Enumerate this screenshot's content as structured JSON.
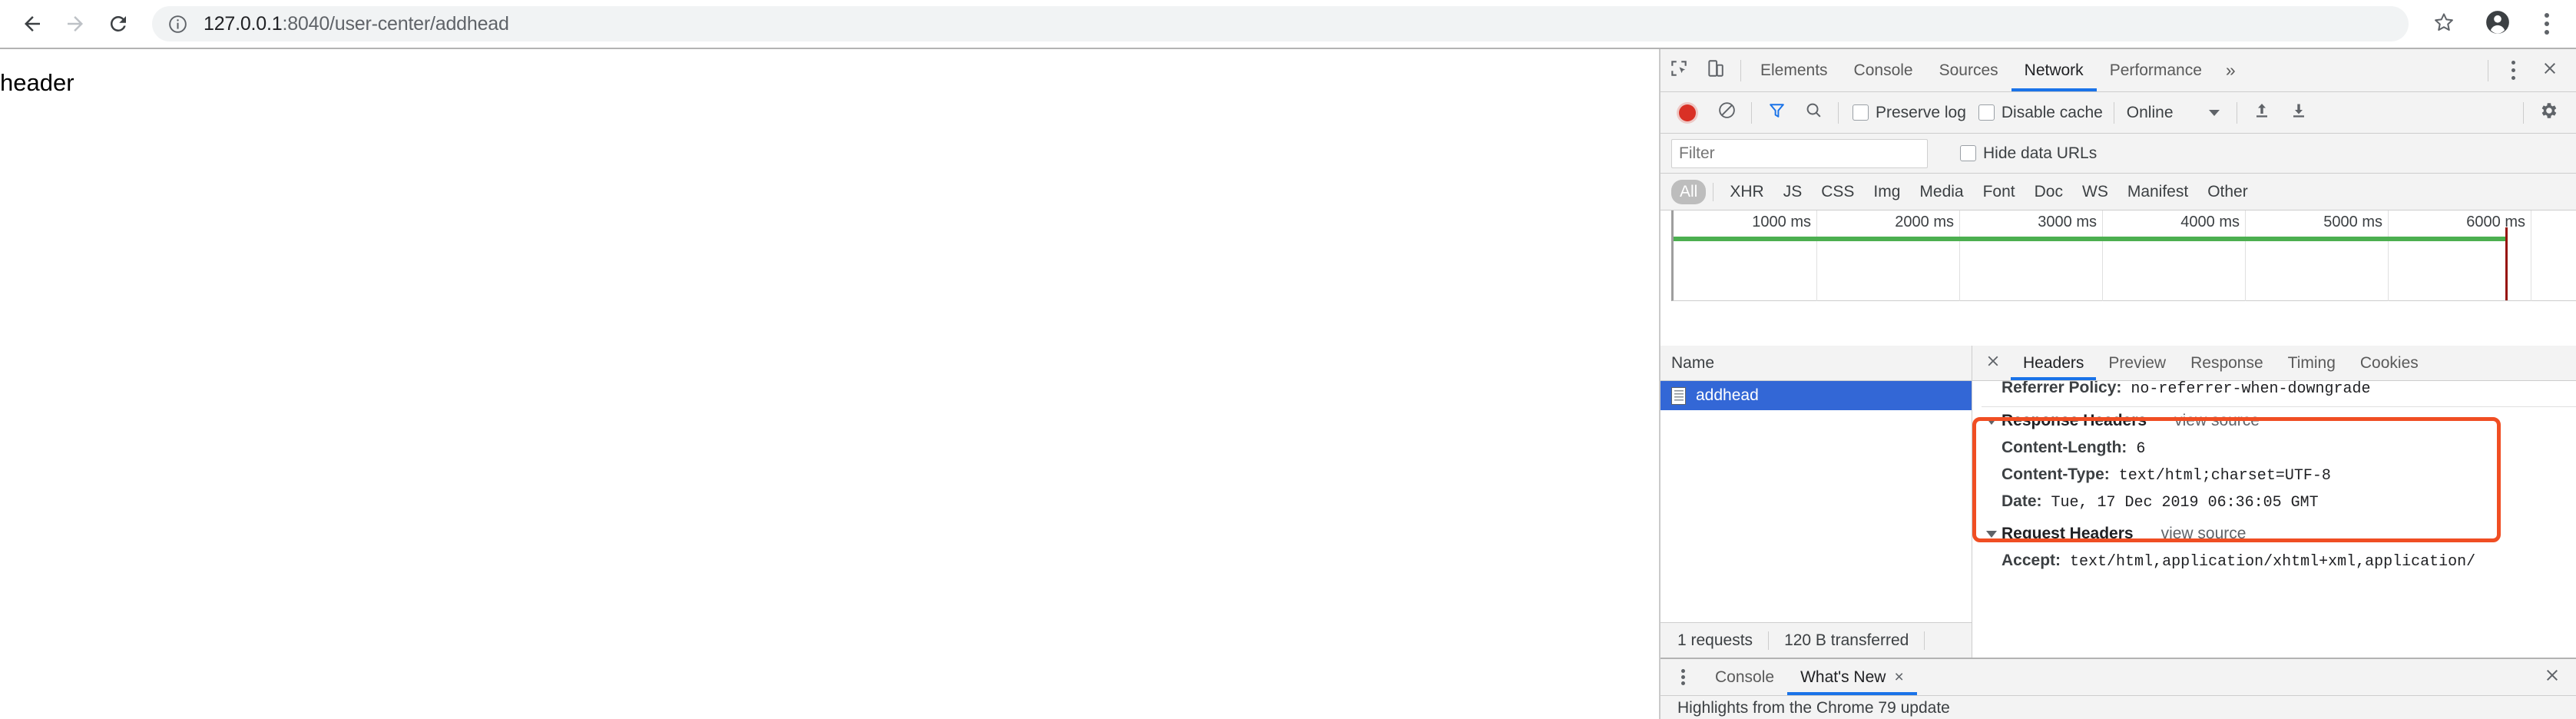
{
  "browser": {
    "back_icon": "arrow-left-icon",
    "forward_icon": "arrow-right-icon",
    "reload_icon": "reload-icon",
    "site_info_icon": "info-circle-icon",
    "url_host": "127.0.0.1",
    "url_rest": ":8040/user-center/addhead",
    "star_icon": "star-icon",
    "profile_icon": "profile-avatar-icon",
    "menu_icon": "kebab-menu-icon"
  },
  "page": {
    "body_text": "header"
  },
  "devtools": {
    "inspect_icon": "inspect-element-icon",
    "device_toolbar_icon": "device-toggle-icon",
    "tabs": [
      {
        "label": "Elements",
        "active": false
      },
      {
        "label": "Console",
        "active": false
      },
      {
        "label": "Sources",
        "active": false
      },
      {
        "label": "Network",
        "active": true
      },
      {
        "label": "Performance",
        "active": false
      }
    ],
    "more_tabs_label": "»",
    "settings_menu_icon": "kebab-menu-icon",
    "close_icon": "close-icon",
    "network_toolbar": {
      "record_icon": "record-button-icon",
      "clear_icon": "clear-network-icon",
      "filter_icon": "funnel-filter-icon",
      "search_icon": "search-icon",
      "preserve_log_label": "Preserve log",
      "preserve_log_checked": false,
      "disable_cache_label": "Disable cache",
      "disable_cache_checked": false,
      "throttling_value": "Online",
      "import_har_icon": "upload-arrow-icon",
      "export_har_icon": "download-arrow-icon",
      "settings_icon": "gear-icon"
    },
    "filter_row": {
      "filter_placeholder": "Filter",
      "filter_value": "",
      "hide_data_urls_label": "Hide data URLs",
      "hide_data_urls_checked": false
    },
    "type_filters": [
      {
        "label": "All",
        "active": true
      },
      {
        "label": "XHR",
        "active": false
      },
      {
        "label": "JS",
        "active": false
      },
      {
        "label": "CSS",
        "active": false
      },
      {
        "label": "Img",
        "active": false
      },
      {
        "label": "Media",
        "active": false
      },
      {
        "label": "Font",
        "active": false
      },
      {
        "label": "Doc",
        "active": false
      },
      {
        "label": "WS",
        "active": false
      },
      {
        "label": "Manifest",
        "active": false
      },
      {
        "label": "Other",
        "active": false
      }
    ],
    "overview": {
      "ticks": [
        "1000 ms",
        "2000 ms",
        "3000 ms",
        "4000 ms",
        "5000 ms",
        "6000 ms"
      ],
      "green_bar_color": "#4caf50",
      "red_marker_color": "#97140d",
      "red_marker_ms": 5820,
      "axis_max_ms": 6000
    },
    "request_list": {
      "column_header": "Name",
      "rows": [
        {
          "name": "addhead",
          "icon": "document-file-icon",
          "selected": true
        }
      ]
    },
    "status_bar": {
      "requests": "1 requests",
      "transferred": "120 B transferred"
    },
    "detail": {
      "close_icon": "close-icon",
      "tabs": [
        {
          "label": "Headers",
          "active": true
        },
        {
          "label": "Preview",
          "active": false
        },
        {
          "label": "Response",
          "active": false
        },
        {
          "label": "Timing",
          "active": false
        },
        {
          "label": "Cookies",
          "active": false
        }
      ],
      "referrer_policy_key": "Referrer Policy:",
      "referrer_policy_value": "no-referrer-when-downgrade",
      "response_headers_title": "Response Headers",
      "response_view_source": "view source",
      "response_headers": [
        {
          "key": "Content-Length:",
          "value": "6"
        },
        {
          "key": "Content-Type:",
          "value": "text/html;charset=UTF-8"
        },
        {
          "key": "Date:",
          "value": "Tue, 17 Dec 2019 06:36:05 GMT"
        }
      ],
      "request_headers_title": "Request Headers",
      "request_view_source": "view source",
      "request_headers": [
        {
          "key": "Accept:",
          "value": "text/html,application/xhtml+xml,application/"
        }
      ],
      "annotation_color": "#f04e23"
    },
    "drawer": {
      "menu_icon": "kebab-menu-icon",
      "tabs": [
        {
          "label": "Console",
          "active": false,
          "closable": false
        },
        {
          "label": "What's New",
          "active": true,
          "closable": true
        }
      ],
      "tab_close_glyph": "×",
      "close_icon": "close-icon",
      "content_text": "Highlights from the Chrome 79 update"
    }
  }
}
